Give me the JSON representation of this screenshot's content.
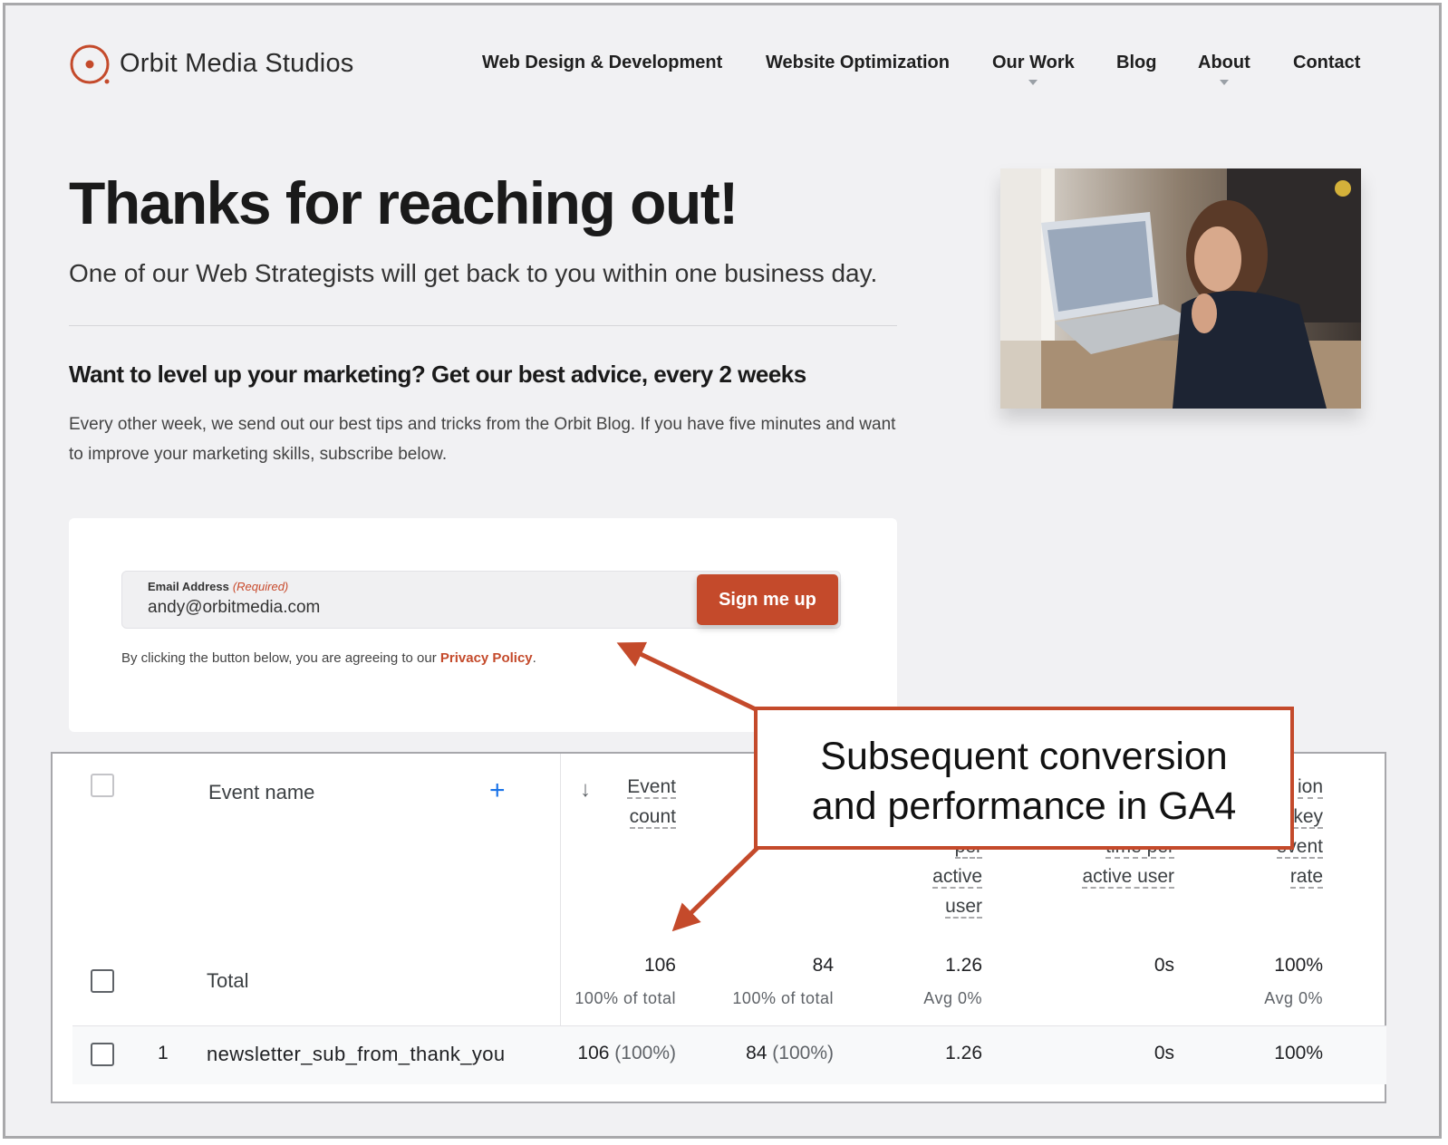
{
  "brand": {
    "name": "Orbit Media Studios",
    "accent": "#c44a2b"
  },
  "nav": {
    "items": [
      {
        "label": "Web Design & Development"
      },
      {
        "label": "Website Optimization"
      },
      {
        "label": "Our Work"
      },
      {
        "label": "Blog"
      },
      {
        "label": "About"
      },
      {
        "label": "Contact"
      }
    ]
  },
  "hero": {
    "title": "Thanks for reaching out!",
    "subtitle": "One of our Web Strategists will get back to you within one business day."
  },
  "newsletter": {
    "heading": "Want to level up your marketing? Get our best advice, every 2 weeks",
    "body": "Every other week, we send out our best tips and tricks from the Orbit Blog. If you have five minutes and want to improve your marketing skills, subscribe below.",
    "email_label": "Email Address",
    "required_label": "(Required)",
    "email_value": "andy@orbitmedia.com",
    "button_label": "Sign me up",
    "agree_text": "By clicking the button below, you are agreeing to our ",
    "privacy_link": "Privacy Policy",
    "agree_end": "."
  },
  "ga4": {
    "header_name": "Event name",
    "add_icon": "plus-icon",
    "sort_icon": "arrow-down-icon",
    "columns": [
      {
        "label": "Event\ncount"
      },
      {
        "label": "per\nactive\nuser"
      },
      {
        "label": "time per\nactive user"
      },
      {
        "label": "ion\nkey\nevent\nrate"
      }
    ],
    "total_label": "Total",
    "totals": [
      {
        "value": "106",
        "sub": "100% of total"
      },
      {
        "value": "84",
        "sub": "100% of total"
      },
      {
        "value": "1.26",
        "sub": "Avg 0%"
      },
      {
        "value": "0s",
        "sub": ""
      },
      {
        "value": "100%",
        "sub": "Avg 0%"
      }
    ],
    "rows": [
      {
        "index": "1",
        "name": "newsletter_sub_from_thank_you",
        "cells": [
          {
            "value": "106",
            "pct": "(100%)"
          },
          {
            "value": "84",
            "pct": "(100%)"
          },
          {
            "value": "1.26",
            "pct": ""
          },
          {
            "value": "0s",
            "pct": ""
          },
          {
            "value": "100%",
            "pct": ""
          }
        ]
      }
    ]
  },
  "callout": {
    "line1": "Subsequent conversion",
    "line2": "and performance in GA4"
  }
}
